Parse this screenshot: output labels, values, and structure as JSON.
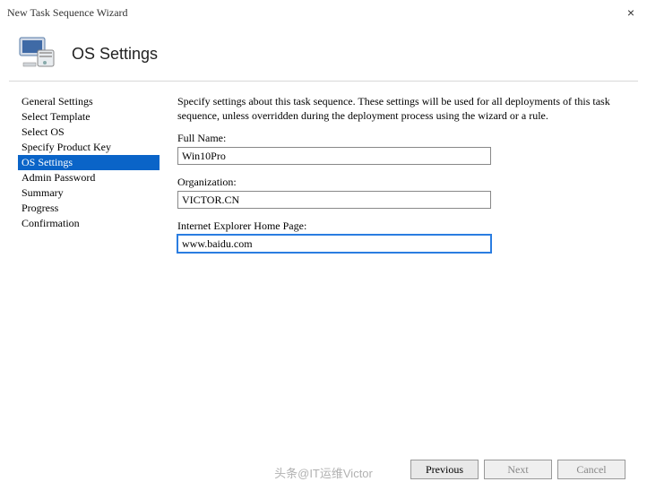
{
  "window": {
    "title": "New Task Sequence Wizard",
    "close_label": "×"
  },
  "header": {
    "title": "OS Settings"
  },
  "sidebar": {
    "items": [
      {
        "label": "General Settings",
        "selected": false
      },
      {
        "label": "Select Template",
        "selected": false
      },
      {
        "label": "Select OS",
        "selected": false
      },
      {
        "label": "Specify Product Key",
        "selected": false
      },
      {
        "label": "OS Settings",
        "selected": true
      },
      {
        "label": "Admin Password",
        "selected": false
      },
      {
        "label": "Summary",
        "selected": false
      },
      {
        "label": "Progress",
        "selected": false
      },
      {
        "label": "Confirmation",
        "selected": false
      }
    ]
  },
  "content": {
    "description": "Specify settings about this task sequence.  These settings will be used for all deployments of this task sequence, unless overridden during the deployment process using the wizard or a rule.",
    "fields": {
      "full_name": {
        "label": "Full Name:",
        "value": "Win10Pro"
      },
      "organization": {
        "label": "Organization:",
        "value": "VICTOR.CN"
      },
      "ie_home": {
        "label": "Internet Explorer Home Page:",
        "value": "www.baidu.com"
      }
    }
  },
  "buttons": {
    "previous": "Previous",
    "next": "Next",
    "cancel": "Cancel"
  },
  "watermark": "头条@IT运维Victor"
}
